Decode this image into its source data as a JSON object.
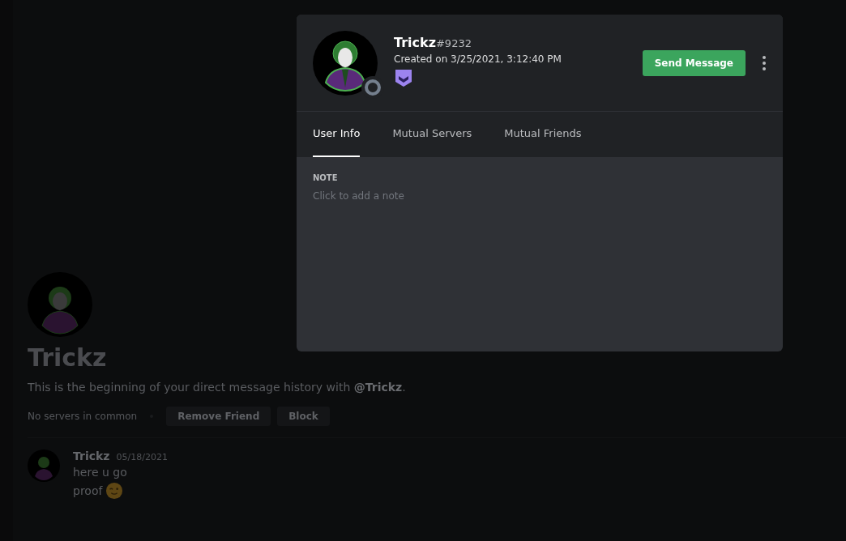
{
  "dm": {
    "name": "Trickz",
    "intro": "This is the beginning of your direct message history with **@Trickz**.",
    "servers": "No servers in common",
    "buttons": [
      "Remove Friend",
      "Block"
    ],
    "messages": [
      {
        "author": "Trickz",
        "date": "05/18/2021",
        "lines": [
          {
            "text": "here u go",
            "emoji": false
          },
          {
            "text": "proof",
            "emoji": true
          }
        ]
      }
    ]
  },
  "profile": {
    "username": "Trickz",
    "discriminator": "#9232",
    "created": "Created on 3/25/2021, 3:12:40 PM",
    "send_button": "Send Message",
    "tabs": [
      {
        "label": "User Info",
        "selected": true
      },
      {
        "label": "Mutual Servers",
        "selected": false
      },
      {
        "label": "Mutual Friends",
        "selected": false
      }
    ],
    "note": {
      "heading": "NOTE",
      "placeholder": "Click to add a note"
    }
  }
}
